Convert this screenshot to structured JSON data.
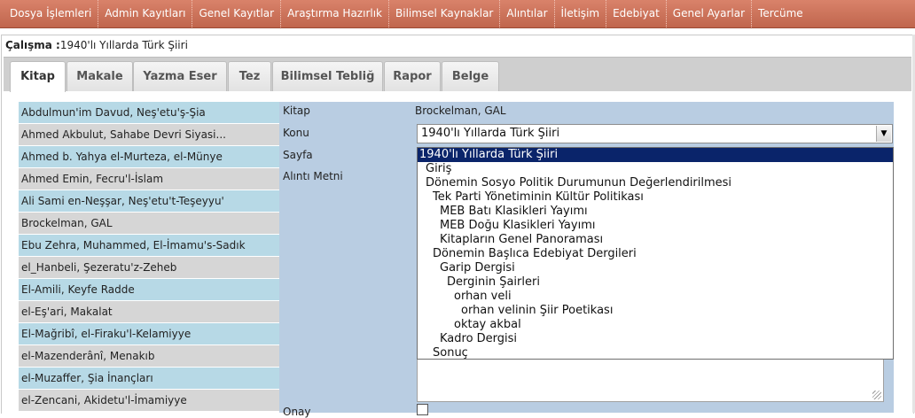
{
  "menu": {
    "items": [
      "Dosya İşlemleri",
      "Admin Kayıtları",
      "Genel Kayıtlar",
      "Araştırma Hazırlık",
      "Bilimsel Kaynaklar",
      "Alıntılar",
      "İletişim",
      "Edebiyat",
      "Genel Ayarlar",
      "Tercüme"
    ]
  },
  "work": {
    "label": "Çalışma :",
    "value": "1940'lı Yıllarda Türk Şiiri"
  },
  "tabs": [
    {
      "label": "Kitap",
      "active": true
    },
    {
      "label": "Makale"
    },
    {
      "label": "Yazma Eser"
    },
    {
      "label": "Tez"
    },
    {
      "label": "Bilimsel Tebliğ"
    },
    {
      "label": "Rapor"
    },
    {
      "label": "Belge"
    }
  ],
  "books": [
    "Abdulmun'im Davud, Neş'etu'ş-Şia",
    "Ahmed Akbulut, Sahabe Devri Siyasi...",
    "Ahmed b. Yahya el-Murteza, el-Münye",
    "Ahmed Emin, Fecru'l-İslam",
    "Ali Sami en-Neşşar, Neş'etu't-Teşeyyu'",
    "Brockelman, GAL",
    "Ebu Zehra, Muhammed, El-İmamu's-Sadık",
    "el_Hanbeli, Şezeratu'z-Zeheb",
    "El-Amili, Keyfe Radde",
    "el-Eş'ari, Makalat",
    "El-Mağribî, el-Firaku'l-Kelamiyye",
    "el-Mazenderânî, Menakıb",
    "el-Muzaffer, Şia İnançları",
    "el-Zencani, Akidetu'l-İmamiyye"
  ],
  "form": {
    "kitap_label": "Kitap",
    "kitap_value": "Brockelman, GAL",
    "konu_label": "Konu",
    "konu_selected": "1940'lı Yıllarda Türk Şiiri",
    "sayfa_label": "Sayfa",
    "alinti_label": "Alıntı Metni",
    "onay_label": "Onay"
  },
  "dropdown": [
    {
      "label": "1940'lı Yıllarda Türk Şiiri",
      "level": 0,
      "selected": true
    },
    {
      "label": "Giriş",
      "level": 1
    },
    {
      "label": "Dönemin Sosyo Politik Durumunun Değerlendirilmesi",
      "level": 1
    },
    {
      "label": "Tek Parti Yönetiminin Kültür Politikası",
      "level": 2
    },
    {
      "label": "MEB Batı Klasikleri Yayımı",
      "level": 3
    },
    {
      "label": "MEB Doğu Klasikleri Yayımı",
      "level": 3
    },
    {
      "label": "Kitapların Genel Panoraması",
      "level": 3
    },
    {
      "label": "Dönemin Başlıca Edebiyat Dergileri",
      "level": 2
    },
    {
      "label": "Garip Dergisi",
      "level": 3
    },
    {
      "label": "Derginin Şairleri",
      "level": 4
    },
    {
      "label": "orhan veli",
      "level": 5
    },
    {
      "label": "orhan velinin Şiir Poetikası",
      "level": 6
    },
    {
      "label": "oktay akbal",
      "level": 5
    },
    {
      "label": "Kadro Dergisi",
      "level": 3
    },
    {
      "label": "Sonuç",
      "level": 2
    }
  ],
  "colors": {
    "menu_bg": "#c8705a",
    "list_blue": "#b7d9e6",
    "list_gray": "#d6d6d6",
    "form_bg": "#b9cde2",
    "selected_option": "#0a246a"
  }
}
